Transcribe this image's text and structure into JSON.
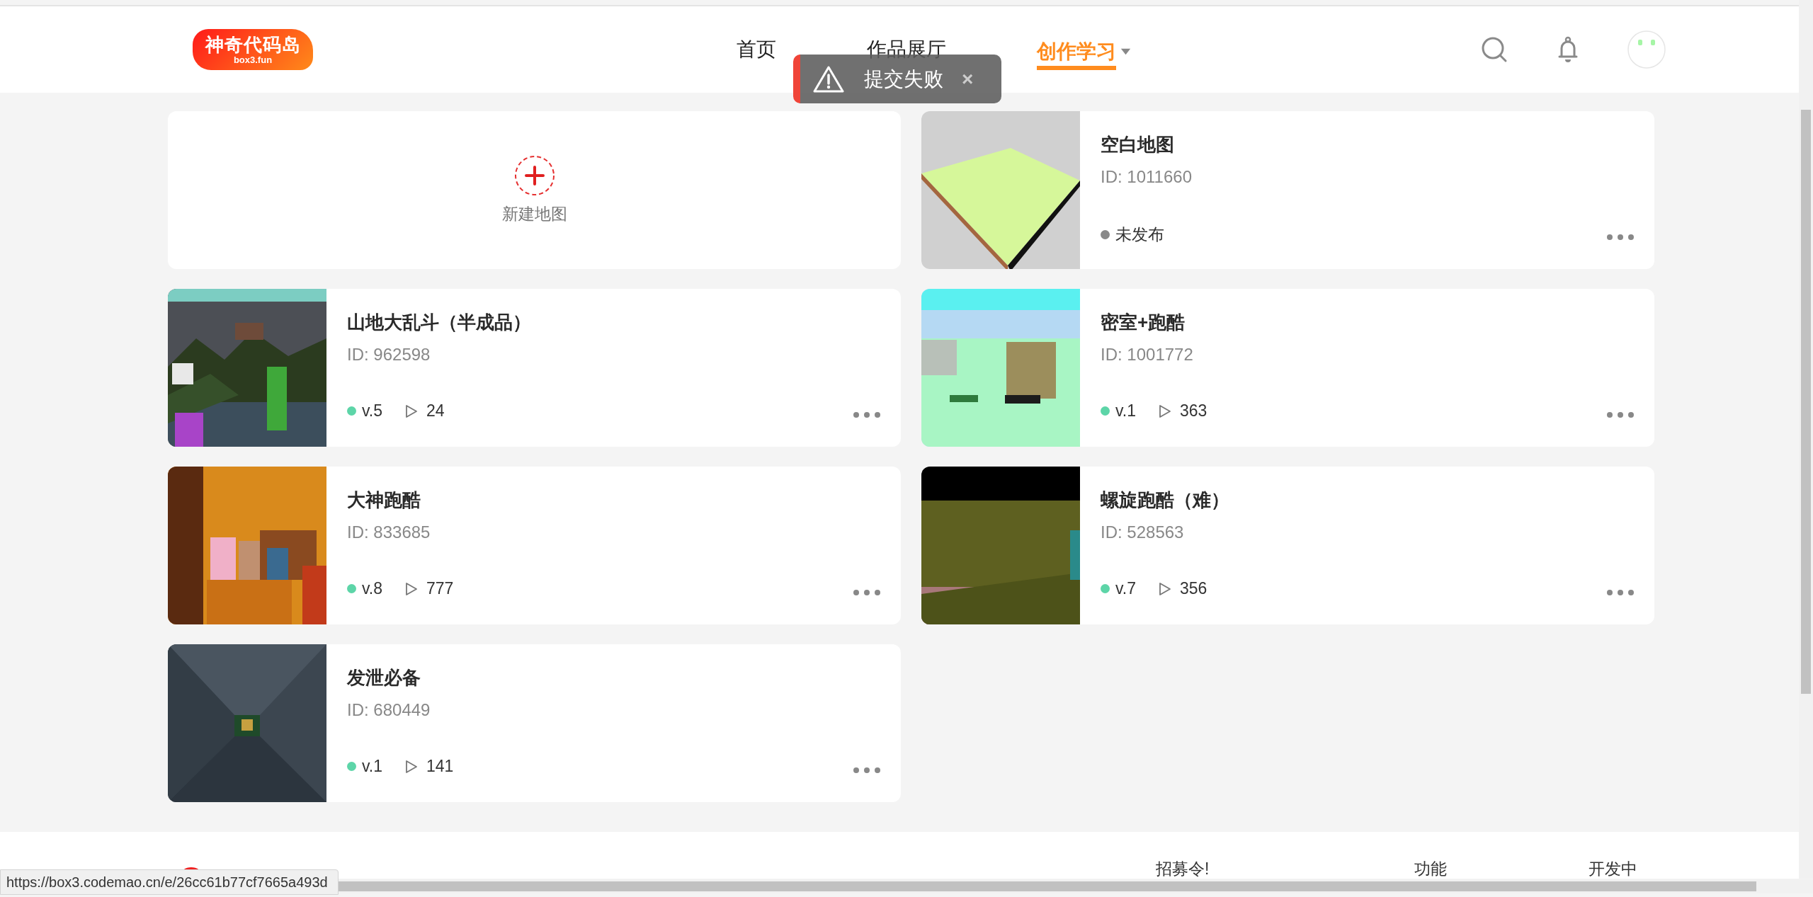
{
  "header": {
    "logo": {
      "title": "神奇代码岛",
      "subtitle": "box3.fun"
    },
    "nav": [
      {
        "label": "首页",
        "selected": false,
        "dropdown": false
      },
      {
        "label": "作品展厅",
        "selected": false,
        "dropdown": false
      },
      {
        "label": "创作学习",
        "selected": true,
        "dropdown": true
      }
    ]
  },
  "toast": {
    "message": "提交失败",
    "close": "×"
  },
  "cards": [
    {
      "kind": "new",
      "label": "新建地图"
    },
    {
      "kind": "map",
      "title": "空白地图",
      "id": "ID: 1011660",
      "published": false,
      "status": "未发布"
    },
    {
      "kind": "map",
      "title": "山地大乱斗（半成品）",
      "id": "ID: 962598",
      "published": true,
      "version": "v.5",
      "plays": "24"
    },
    {
      "kind": "map",
      "title": "密室+跑酷",
      "id": "ID: 1001772",
      "published": true,
      "version": "v.1",
      "plays": "363"
    },
    {
      "kind": "map",
      "title": "大神跑酷",
      "id": "ID: 833685",
      "published": true,
      "version": "v.8",
      "plays": "777"
    },
    {
      "kind": "map",
      "title": "螺旋跑酷（难）",
      "id": "ID: 528563",
      "published": true,
      "version": "v.7",
      "plays": "356"
    },
    {
      "kind": "map",
      "title": "发泄必备",
      "id": "ID: 680449",
      "published": true,
      "version": "v.1",
      "plays": "141"
    }
  ],
  "footer": {
    "links": [
      "招募令!",
      "功能",
      "开发中"
    ]
  },
  "status_url": "https://box3.codemao.cn/e/26cc61b77cf7665a493d"
}
